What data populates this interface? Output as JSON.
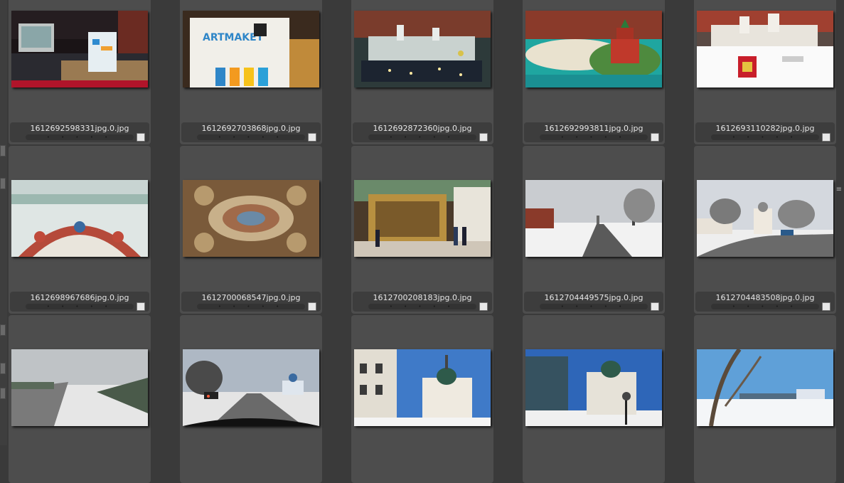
{
  "lighttable": {
    "rows": [
      [
        {
          "filename": "1612692598331jpg.0.jpg",
          "rating": "• • • • •",
          "scene": "museum-reception",
          "selected": false
        },
        {
          "filename": "1612692703868jpg.0.jpg",
          "rating": "• • • • •",
          "scene": "artmaket-sign",
          "selected": false
        },
        {
          "filename": "1612692872360jpg.0.jpg",
          "rating": "• • • • •",
          "scene": "model-kremlin-night",
          "selected": false
        },
        {
          "filename": "1612692993811jpg.0.jpg",
          "rating": "• • • • •",
          "scene": "model-island-church",
          "selected": false
        },
        {
          "filename": "1612693110282jpg.0.jpg",
          "rating": "• • • • •",
          "scene": "model-rostov",
          "selected": false
        }
      ],
      [
        {
          "filename": "1612698967686jpg.0.jpg",
          "rating": "• • • • •",
          "scene": "church-arch-frescoes",
          "selected": false
        },
        {
          "filename": "1612700068547jpg.0.jpg",
          "rating": "• • • • •",
          "scene": "ceiling-frescoes",
          "selected": false
        },
        {
          "filename": "1612700208183jpg.0.jpg",
          "rating": "• • • • •",
          "scene": "church-interior-iconostasis",
          "selected": false
        },
        {
          "filename": "1612704449575jpg.0.jpg",
          "rating": "• • • • •",
          "scene": "winter-village-road",
          "selected": false
        },
        {
          "filename": "1612704483508jpg.0.jpg",
          "rating": "• • • • •",
          "scene": "winter-road-church",
          "selected": false
        }
      ],
      [
        {
          "filename": "",
          "rating": "",
          "scene": "snowy-highway",
          "selected": false
        },
        {
          "filename": "",
          "rating": "",
          "scene": "car-dashboard-road",
          "selected": false
        },
        {
          "filename": "",
          "rating": "",
          "scene": "white-church-buildings",
          "selected": false
        },
        {
          "filename": "",
          "rating": "",
          "scene": "white-church-trees",
          "selected": false
        },
        {
          "filename": "",
          "rating": "",
          "scene": "winter-park-birches",
          "selected": false
        }
      ]
    ]
  }
}
